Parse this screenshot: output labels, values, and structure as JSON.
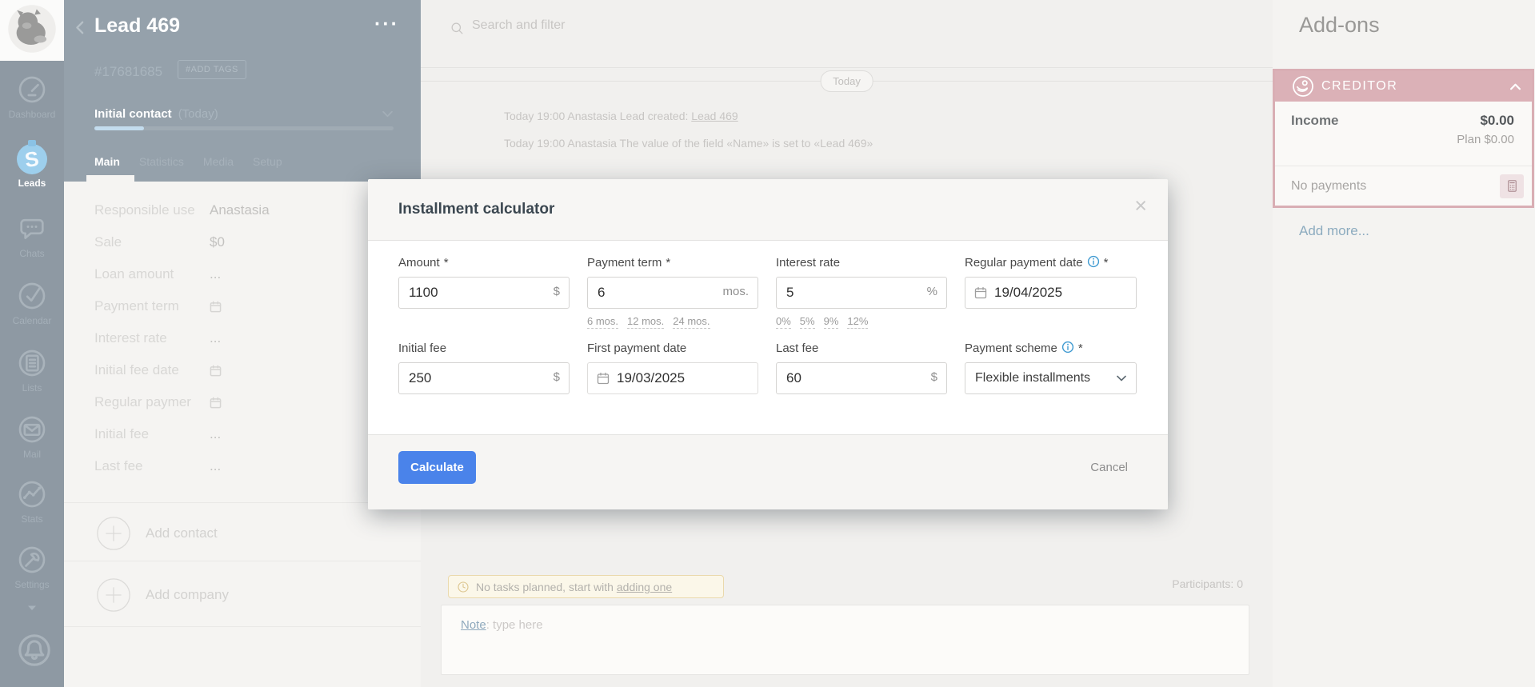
{
  "sidebar": {
    "nav": [
      {
        "label": "Dashboard"
      },
      {
        "label": "Leads"
      },
      {
        "label": "Chats"
      },
      {
        "label": "Calendar"
      },
      {
        "label": "Lists"
      },
      {
        "label": "Mail"
      },
      {
        "label": "Stats"
      },
      {
        "label": "Settings"
      }
    ]
  },
  "lead": {
    "title": "Lead 469",
    "id": "#17681685",
    "add_tags_label": "#ADD TAGS",
    "stage": "Initial contact",
    "stage_hint": "(Today)",
    "tabs": [
      {
        "label": "Main"
      },
      {
        "label": "Statistics"
      },
      {
        "label": "Media"
      },
      {
        "label": "Setup"
      }
    ],
    "fields": [
      {
        "label": "Responsible use",
        "value": "Anastasia"
      },
      {
        "label": "Sale",
        "value": "$0"
      },
      {
        "label": "Loan amount",
        "value": "..."
      },
      {
        "label": "Payment term",
        "value": ""
      },
      {
        "label": "Interest rate",
        "value": "..."
      },
      {
        "label": "Initial fee date",
        "value": ""
      },
      {
        "label": "Regular paymer",
        "value": ""
      },
      {
        "label": "Initial fee",
        "value": "..."
      },
      {
        "label": "Last fee",
        "value": "..."
      }
    ],
    "add_contact_label": "Add contact",
    "add_company_label": "Add company"
  },
  "feed": {
    "search_placeholder": "Search and filter",
    "date_divider": "Today",
    "events": [
      {
        "prefix": "Today 19:00 Anastasia Lead created: ",
        "link": "Lead 469"
      },
      {
        "prefix": "Today 19:00 Anastasia The value of the field «Name» is set to «Lead 469»",
        "link": ""
      }
    ],
    "task_banner": {
      "text": "No tasks planned, start with ",
      "link_label": "adding one"
    },
    "participants_label": "Participants: 0",
    "note": {
      "label": "Note",
      "placeholder": ": type here"
    }
  },
  "addons": {
    "title": "Add-ons",
    "creditor": {
      "name": "CREDITOR",
      "income_label": "Income",
      "income_value": "$0.00",
      "plan_value": "Plan $0.00",
      "payments_status": "No payments"
    },
    "add_more_label": "Add more..."
  },
  "modal": {
    "title": "Installment calculator",
    "close_label": "×",
    "fields": {
      "amount": {
        "label": "Amount",
        "required_mark": "*",
        "value": "1100",
        "unit": "$"
      },
      "payment_term": {
        "label": "Payment term",
        "required_mark": "*",
        "value": "6",
        "unit": "mos.",
        "presets": [
          "6 mos.",
          "12 mos.",
          "24 mos."
        ]
      },
      "interest_rate": {
        "label": "Interest rate",
        "value": "5",
        "unit": "%",
        "presets": [
          "0%",
          "5%",
          "9%",
          "12%"
        ]
      },
      "regular_payment_date": {
        "label": "Regular payment date",
        "required_mark": "*",
        "value": "19/04/2025"
      },
      "initial_fee": {
        "label": "Initial fee",
        "value": "250",
        "unit": "$"
      },
      "first_payment_date": {
        "label": "First payment date",
        "value": "19/03/2025"
      },
      "last_fee": {
        "label": "Last fee",
        "value": "60",
        "unit": "$"
      },
      "payment_scheme": {
        "label": "Payment scheme",
        "required_mark": "*",
        "value": "Flexible installments"
      }
    },
    "calculate_label": "Calculate",
    "cancel_label": "Cancel"
  },
  "colors": {
    "accent_blue": "#4a83ea",
    "info_blue": "#3f9ad1",
    "creditor_pink": "#dbb1b7",
    "leads_icon_blue": "#9dcfed",
    "link_blue": "#8cabbf",
    "sidebar_gray": "#8e99a3"
  }
}
